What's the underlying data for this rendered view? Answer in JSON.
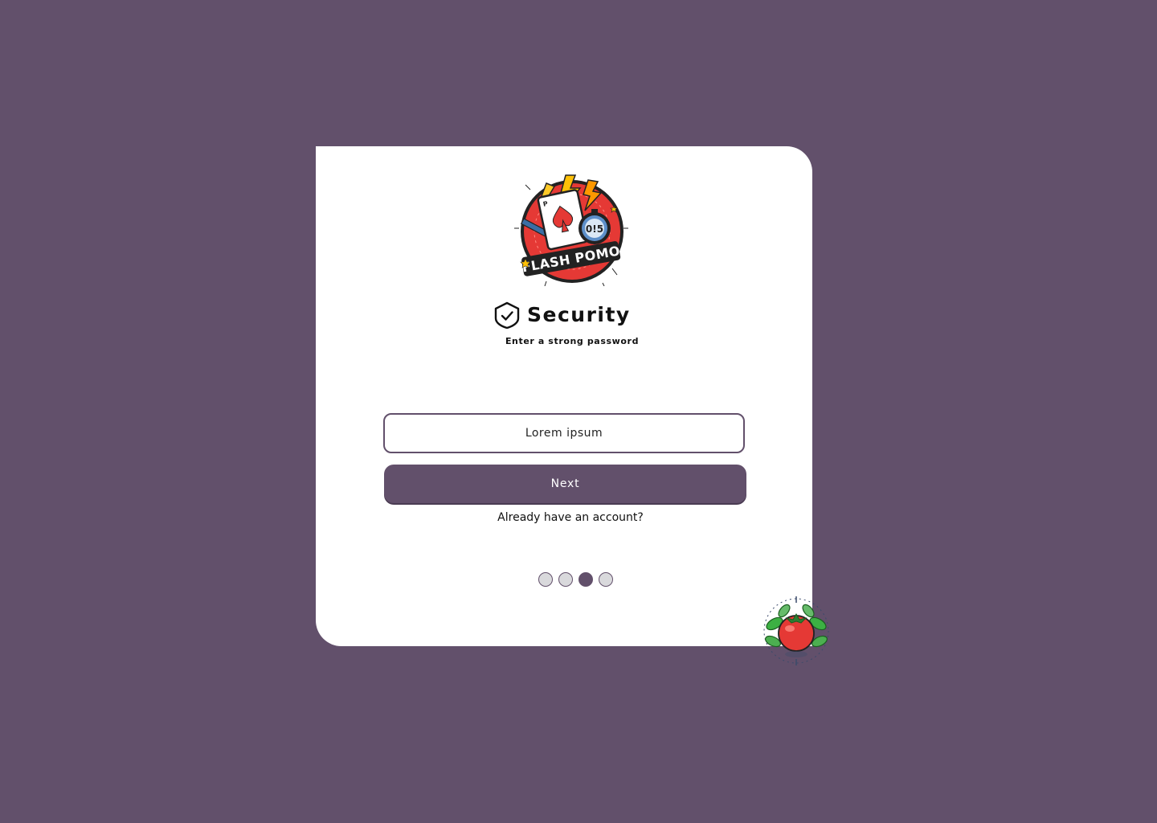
{
  "app": {
    "logo_name": "flash-pomo-logo",
    "logo_text": "FLASH POMO",
    "logo_timer": "0!5",
    "mascot_name": "tomato-icon"
  },
  "heading": {
    "icon": "shield-check-icon",
    "title": "Security",
    "subtitle": "Enter a strong password"
  },
  "form": {
    "password_placeholder": "Lorem ipsum",
    "password_value": "",
    "next_label": "Next",
    "account_link": "Already have an account?"
  },
  "pagination": {
    "total": 4,
    "active_step": 3
  },
  "colors": {
    "background": "#62506b",
    "card": "#ffffff",
    "accent": "#62506b",
    "dot_inactive": "#d9d9dc",
    "tomato_red": "#e53935",
    "leaf_green": "#3cb043"
  }
}
